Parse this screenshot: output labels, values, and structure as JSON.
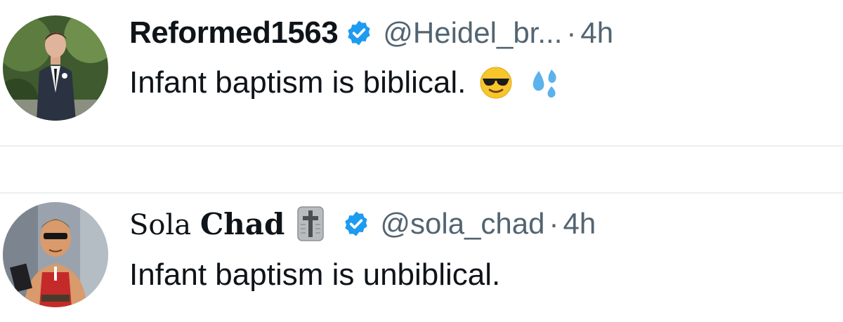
{
  "tweets": [
    {
      "display_name": "Reformed1563",
      "handle": "@Heidel_br...",
      "separator": "·",
      "time": "4h",
      "text": "Infant baptism is biblical.",
      "emoji": [
        "sunglasses-emoji",
        "sweat-droplets-emoji"
      ]
    },
    {
      "display_name_parts": [
        "Sola ",
        "Chad"
      ],
      "handle": "@sola_chad",
      "separator": "·",
      "time": "4h",
      "text": "Infant baptism is unbiblical.",
      "name_icon": "cross-icon"
    }
  ],
  "colors": {
    "verified": "#1d9bf0",
    "muted_text": "#536471",
    "divider": "#eceef0"
  }
}
